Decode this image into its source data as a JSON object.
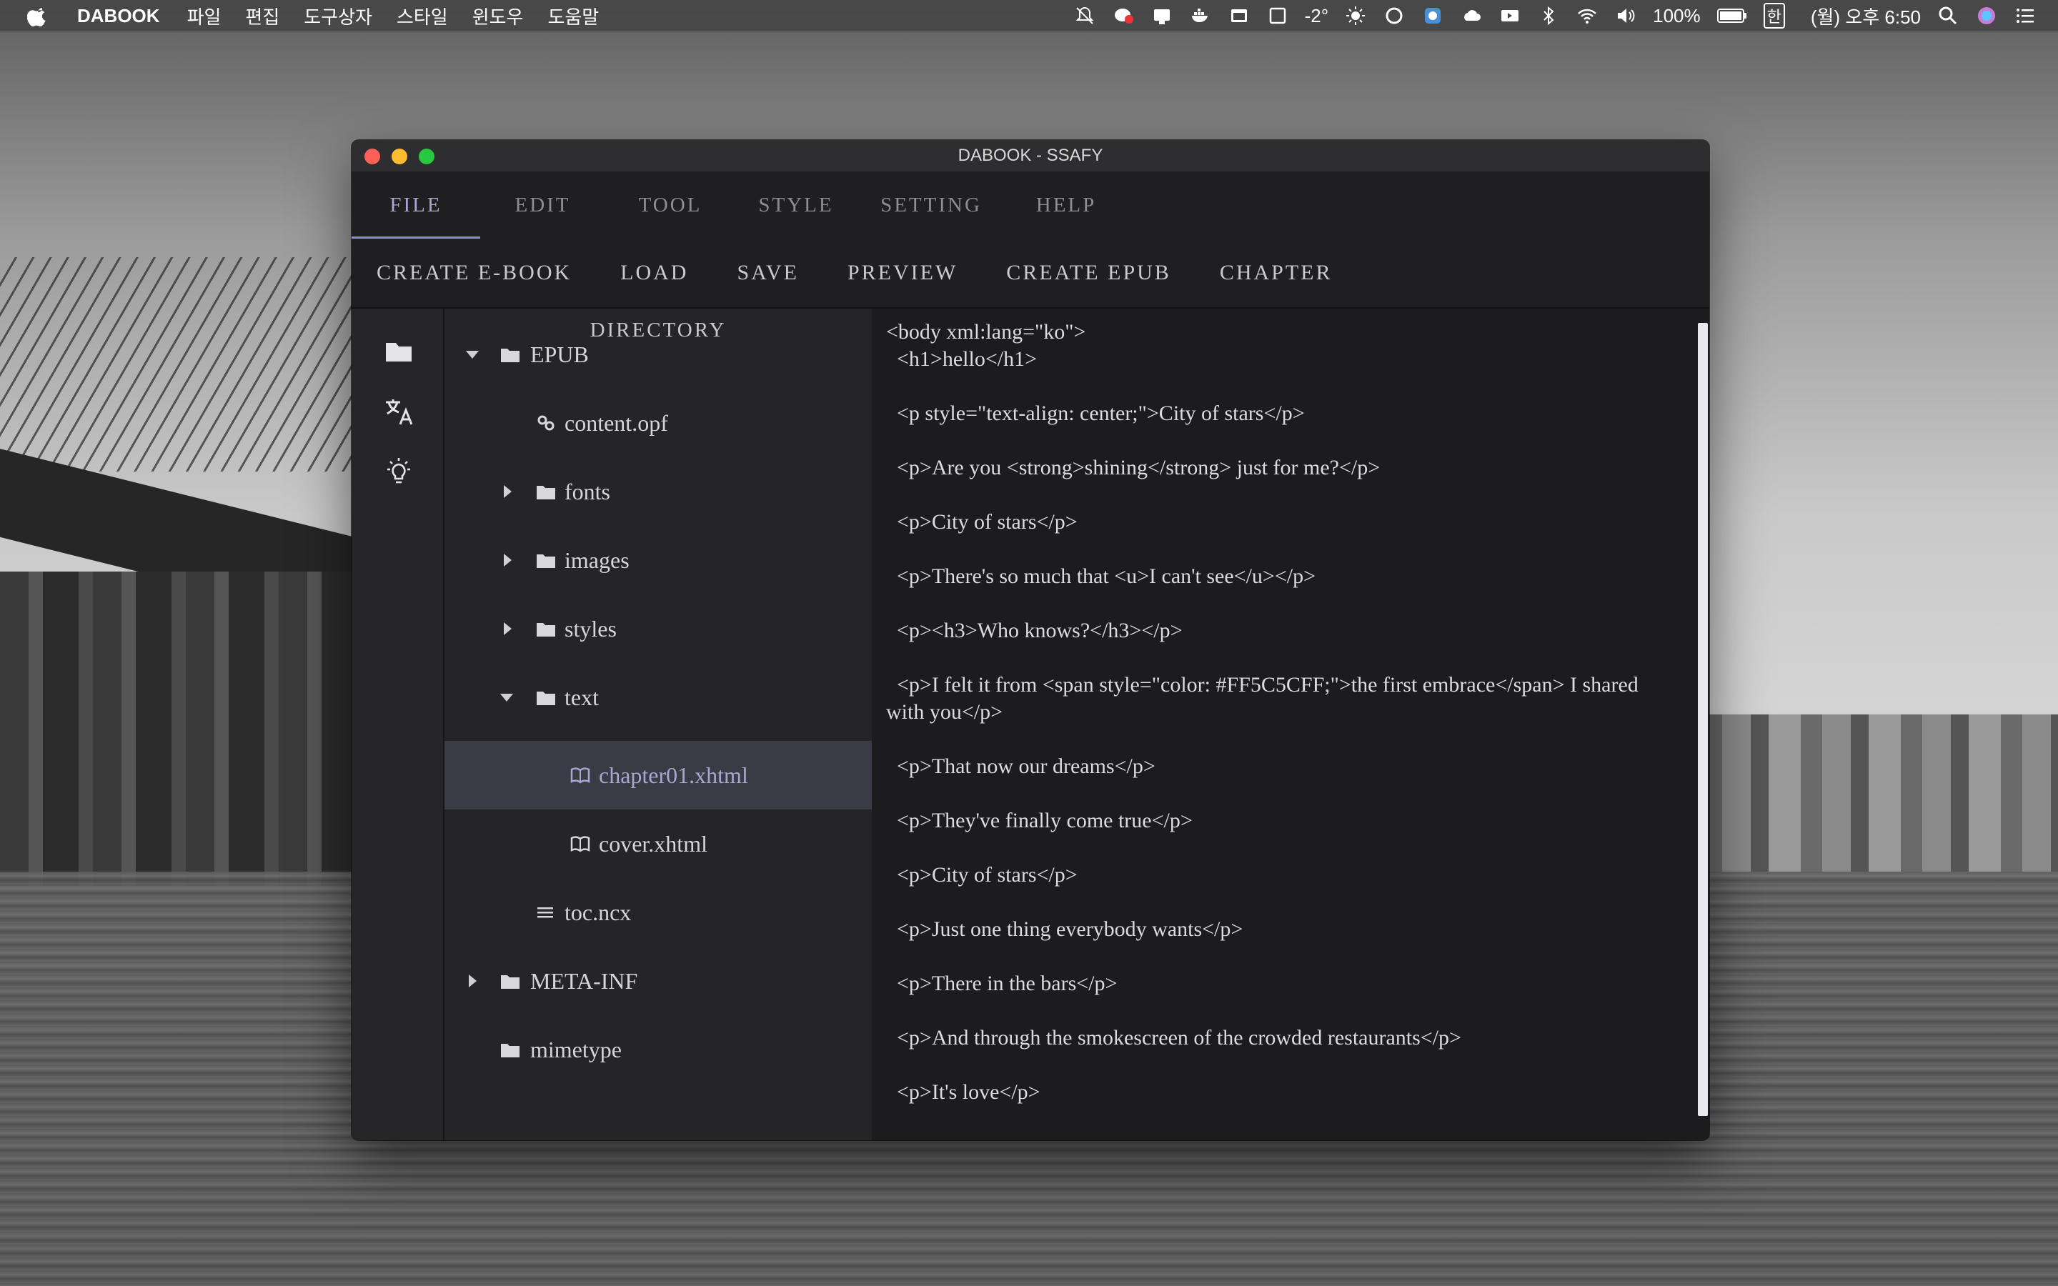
{
  "menubar": {
    "app_name": "DABOOK",
    "items": [
      "파일",
      "편집",
      "도구상자",
      "스타일",
      "윈도우",
      "도움말"
    ],
    "temperature": "-2°",
    "battery": "100%",
    "input_source": "한",
    "clock": "(월) 오후 6:50"
  },
  "window": {
    "title": "DABOOK - SSAFY"
  },
  "tabs": [
    {
      "label": "FILE",
      "active": true
    },
    {
      "label": "EDIT",
      "active": false
    },
    {
      "label": "TOOL",
      "active": false
    },
    {
      "label": "STYLE",
      "active": false
    },
    {
      "label": "SETTING",
      "active": false
    },
    {
      "label": "HELP",
      "active": false
    }
  ],
  "toolbar": [
    "CREATE E-BOOK",
    "LOAD",
    "SAVE",
    "PREVIEW",
    "CREATE EPUB",
    "CHAPTER"
  ],
  "sidebar_icons": [
    "folder-icon",
    "translate-icon",
    "lightbulb-icon"
  ],
  "directory": {
    "title": "DIRECTORY",
    "nodes": [
      {
        "label": "EPUB",
        "icon": "folder-icon",
        "expander": "expanded",
        "depth": 0
      },
      {
        "label": "content.opf",
        "icon": "gears-icon",
        "expander": "none",
        "depth": 1
      },
      {
        "label": "fonts",
        "icon": "folder-icon",
        "expander": "collapsed",
        "depth": 1
      },
      {
        "label": "images",
        "icon": "folder-icon",
        "expander": "collapsed",
        "depth": 1
      },
      {
        "label": "styles",
        "icon": "folder-icon",
        "expander": "collapsed",
        "depth": 1
      },
      {
        "label": "text",
        "icon": "folder-icon",
        "expander": "expanded",
        "depth": 1
      },
      {
        "label": "chapter01.xhtml",
        "icon": "book-icon",
        "expander": "none",
        "depth": 2,
        "selected": true
      },
      {
        "label": "cover.xhtml",
        "icon": "book-icon",
        "expander": "none",
        "depth": 2
      },
      {
        "label": "toc.ncx",
        "icon": "list-icon",
        "expander": "none",
        "depth": 1
      },
      {
        "label": "META-INF",
        "icon": "folder-icon",
        "expander": "collapsed",
        "depth": 0
      },
      {
        "label": "mimetype",
        "icon": "folder-icon",
        "expander": "none",
        "depth": 0
      }
    ]
  },
  "editor": {
    "lines": [
      "<body xml:lang=\"ko\">",
      "  <h1>hello</h1>",
      "",
      "  <p style=\"text-align: center;\">City of stars</p>",
      "",
      "  <p>Are you <strong>shining</strong> just for me?</p>",
      "",
      "  <p>City of stars</p>",
      "",
      "  <p>There's so much that <u>I can't see</u></p>",
      "",
      "  <p><h3>Who knows?</h3></p>",
      "",
      "  <p>I felt it from <span style=\"color: #FF5C5CFF;\">the first embrace</span> I shared with you</p>",
      "",
      "  <p>That now our dreams</p>",
      "",
      "  <p>They've finally come true</p>",
      "",
      "  <p>City of stars</p>",
      "",
      "  <p>Just one thing everybody wants</p>",
      "",
      "  <p>There in the bars</p>",
      "",
      "  <p>And through the smokescreen of the crowded restaurants</p>",
      "",
      "  <p>It's love</p>"
    ]
  },
  "colors": {
    "accent": "#A7A7D2",
    "window_bg": "#1C1C1E",
    "panel_bg": "#252527",
    "selected_row": "#3B3B46"
  }
}
